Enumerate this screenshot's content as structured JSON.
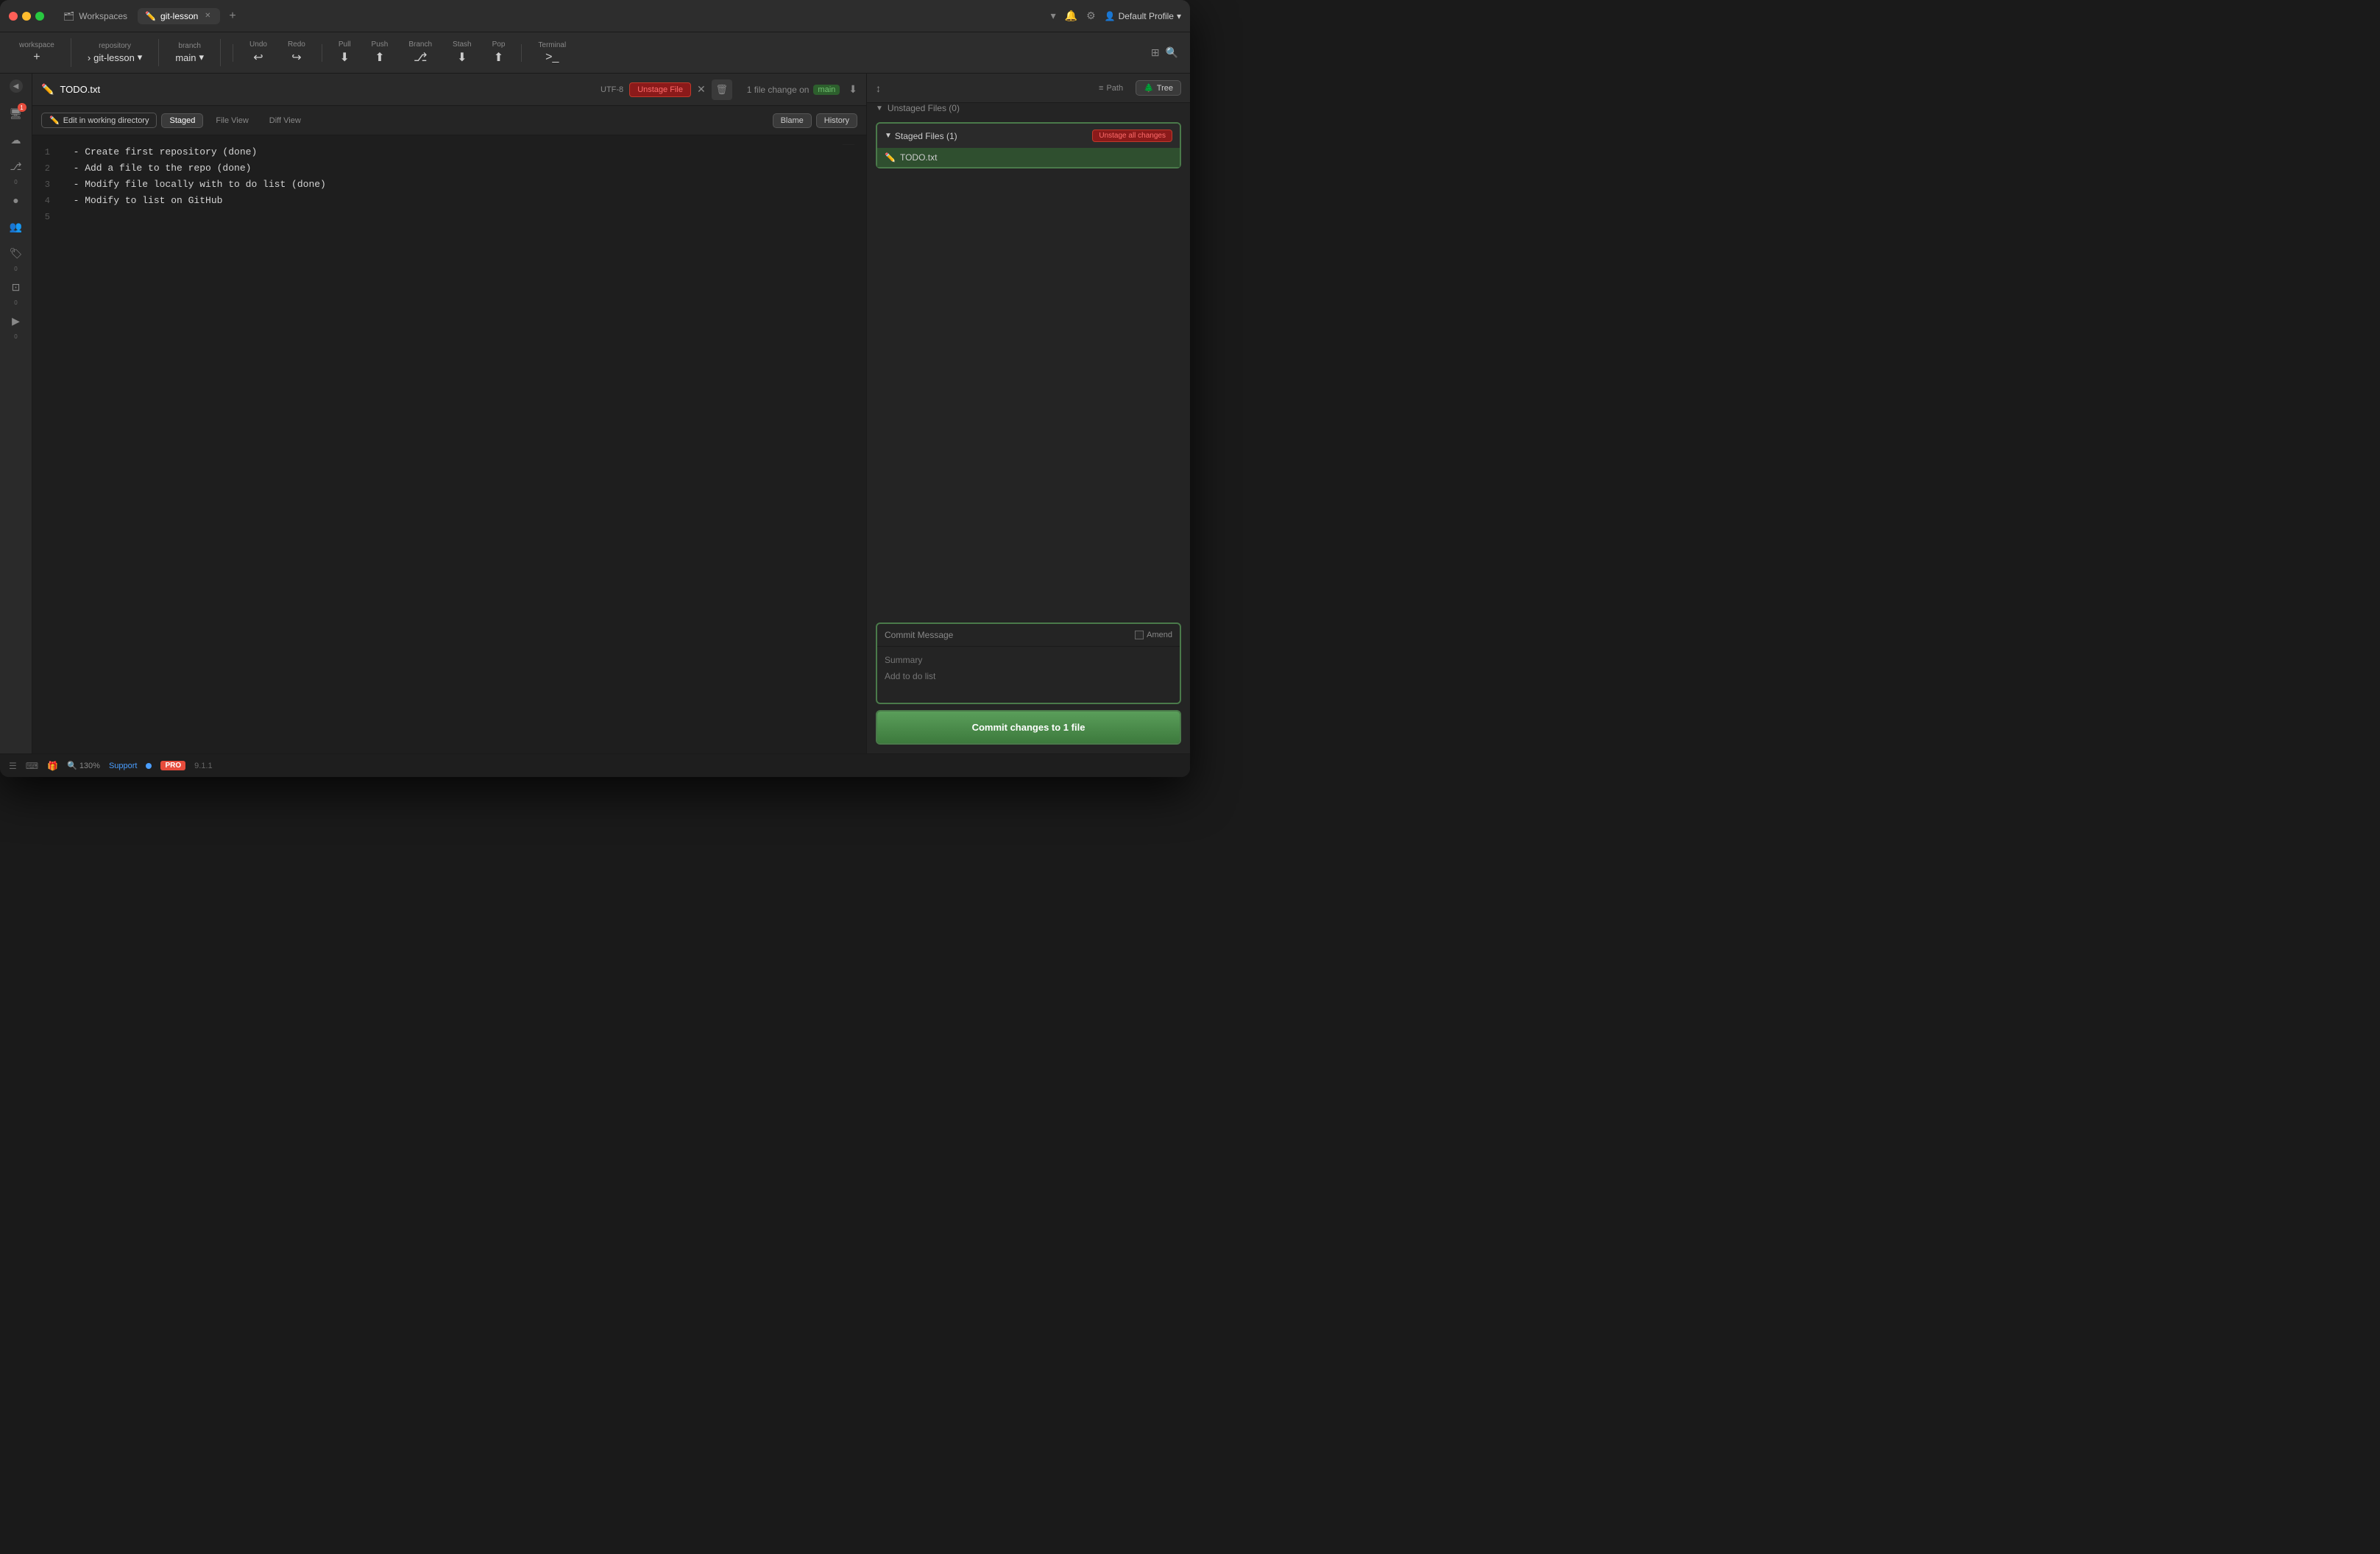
{
  "window": {
    "title": "git-lesson"
  },
  "title_bar": {
    "workspaces_label": "Workspaces",
    "git_lesson_label": "git-lesson",
    "add_tab_label": "+",
    "profile_label": "Default Profile",
    "chevron_down": "▾"
  },
  "toolbar": {
    "workspace_label": "workspace",
    "workspace_add": "+",
    "repository_label": "repository",
    "repo_arrow": "›",
    "repo_name": "git-lesson",
    "repo_dropdown": "▾",
    "branch_label": "branch",
    "branch_name": "main",
    "branch_dropdown": "▾",
    "undo_label": "Undo",
    "redo_label": "Redo",
    "pull_label": "Pull",
    "push_label": "Push",
    "branch_btn_label": "Branch",
    "stash_label": "Stash",
    "pop_label": "Pop",
    "terminal_label": "Terminal"
  },
  "file_header": {
    "filename": "TODO.txt",
    "encoding": "UTF-8",
    "unstage_btn": "Unstage File",
    "file_change_info": "1 file change on",
    "branch_badge": "main"
  },
  "editor_toolbar": {
    "edit_working_btn": "Edit in working directory",
    "staged_tab": "Staged",
    "file_view_tab": "File View",
    "diff_view_tab": "Diff View",
    "blame_btn": "Blame",
    "history_btn": "History"
  },
  "code": {
    "lines": [
      {
        "num": "1",
        "content": "  - Create first repository (done)"
      },
      {
        "num": "2",
        "content": "  - Add a file to the repo (done)"
      },
      {
        "num": "3",
        "content": "  - Modify file locally with to do list (done)"
      },
      {
        "num": "4",
        "content": "  - Modify to list on GitHub"
      },
      {
        "num": "5",
        "content": ""
      }
    ]
  },
  "right_panel": {
    "path_btn": "Path",
    "tree_btn": "Tree",
    "unstaged_section": "Unstaged Files (0)",
    "staged_section": "Staged Files (1)",
    "unstage_all_btn": "Unstage all changes",
    "staged_file": "TODO.txt",
    "commit_header": "Commit Message",
    "amend_label": "Amend",
    "summary_placeholder": "Summary",
    "description_placeholder": "Add to do list",
    "commit_btn": "Commit changes to 1 file"
  },
  "status_bar": {
    "zoom": "130%",
    "support": "Support",
    "pro": "PRO",
    "version": "9.1.1"
  }
}
